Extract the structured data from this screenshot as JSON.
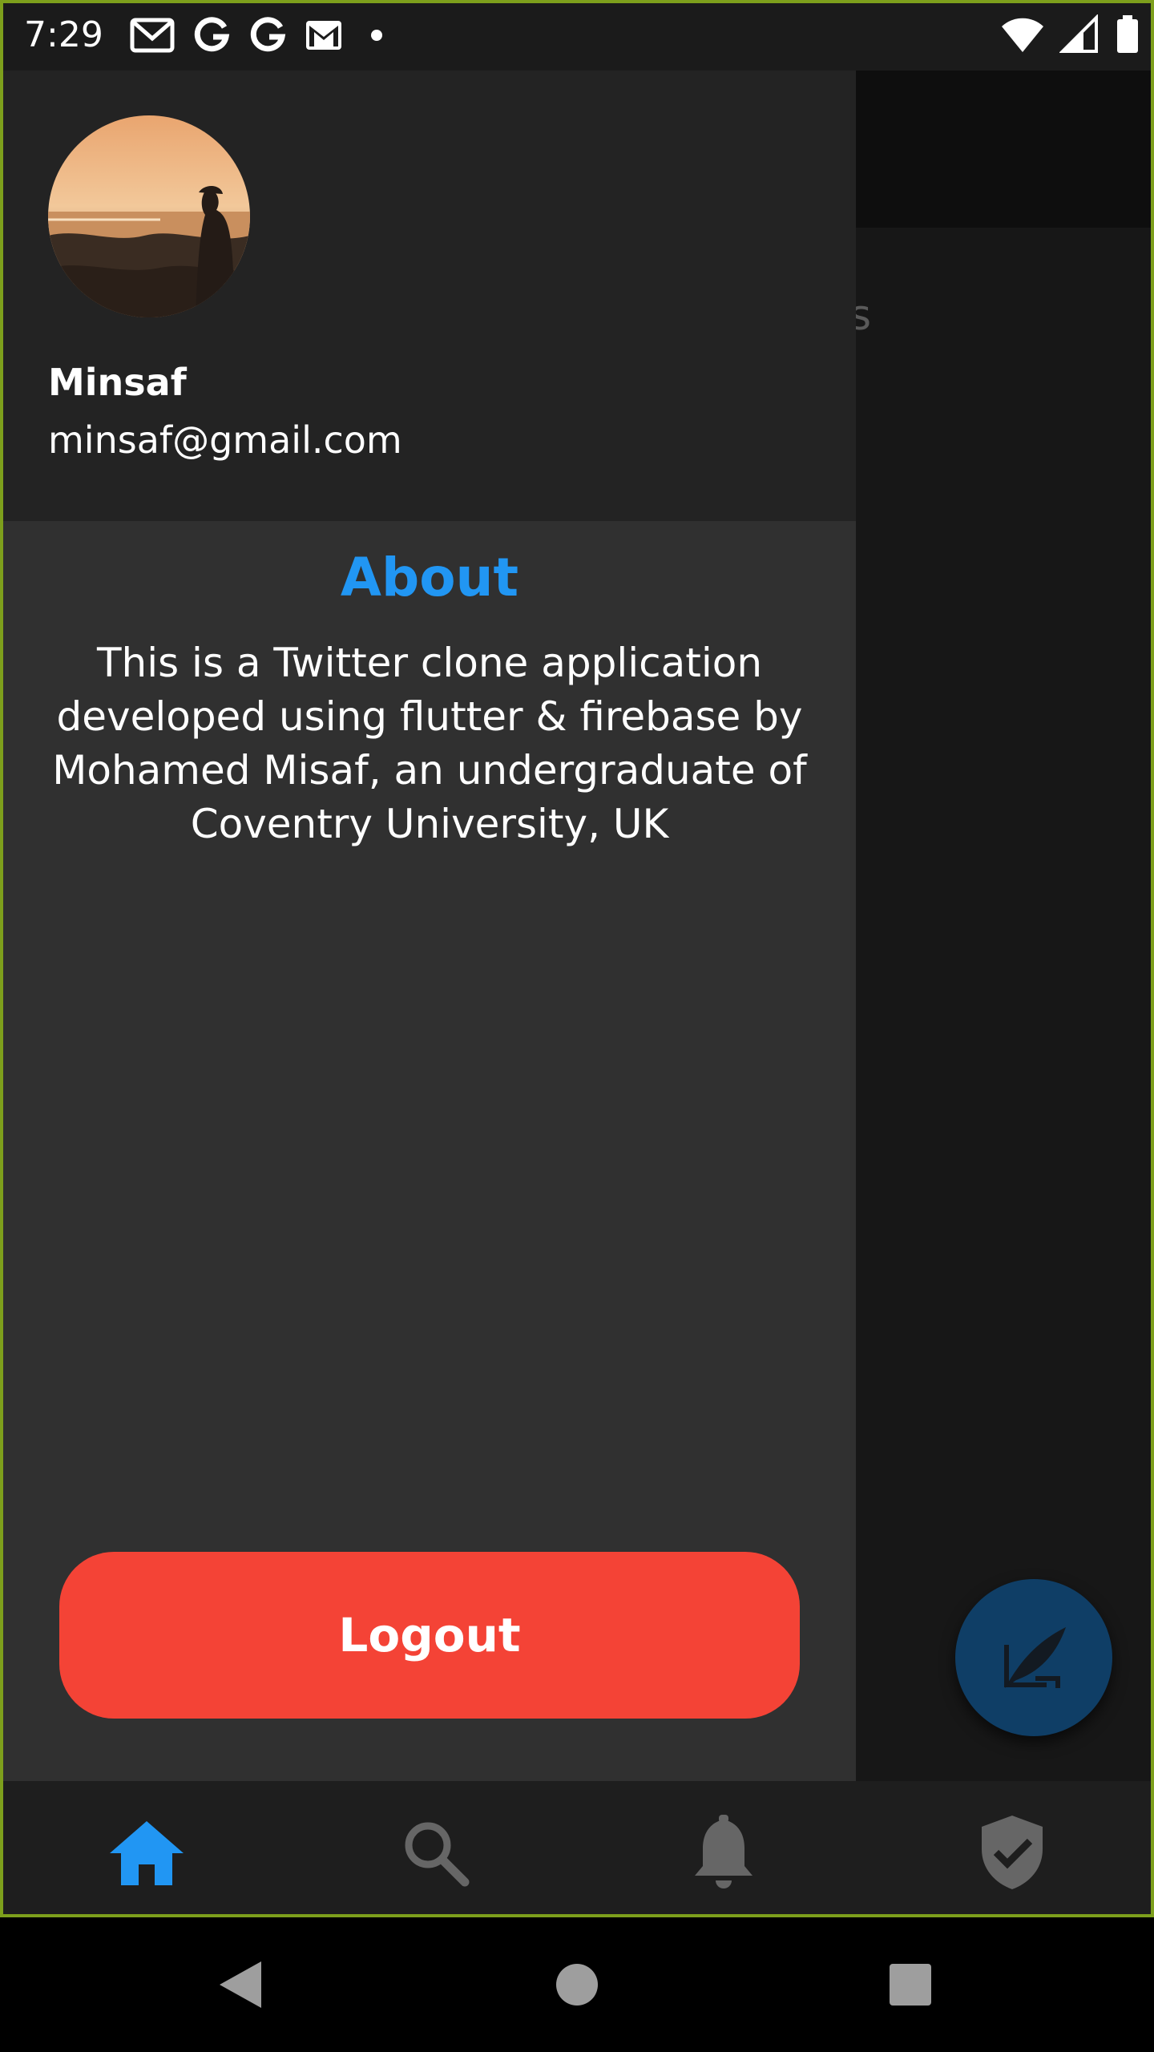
{
  "status_bar": {
    "time": "7:29",
    "notification_icons": [
      "gmail-icon",
      "google-icon",
      "google-icon",
      "gmail-icon",
      "dot-icon"
    ],
    "system_icons": [
      "wifi-icon",
      "signal-icon",
      "battery-icon"
    ]
  },
  "background": {
    "peek_text": "s"
  },
  "drawer": {
    "user": {
      "name": "Minsaf",
      "email": "minsaf@gmail.com"
    },
    "about": {
      "title": "About",
      "text": "This is a Twitter clone application developed using flutter & firebase by Mohamed Misaf, an undergraduate of Coventry University, UK"
    },
    "logout_label": "Logout"
  },
  "bottom_nav": {
    "items": [
      {
        "icon": "home-icon",
        "active": true
      },
      {
        "icon": "search-icon",
        "active": false
      },
      {
        "icon": "bell-icon",
        "active": false
      },
      {
        "icon": "shield-check-icon",
        "active": false
      }
    ]
  },
  "colors": {
    "accent": "#2196f3",
    "logout": "#f44336",
    "drawer_bg": "#303030",
    "drawer_header_bg": "#232323",
    "fab": "#0f3e66"
  }
}
